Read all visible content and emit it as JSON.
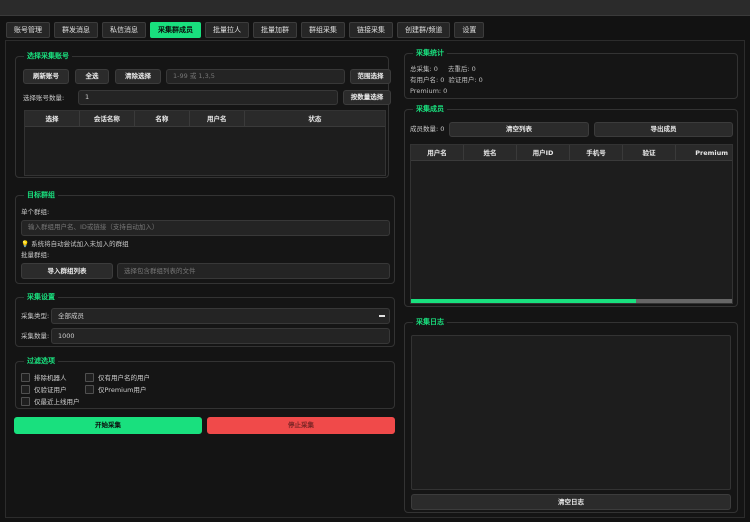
{
  "tabs": [
    {
      "label": "账号管理",
      "active": false
    },
    {
      "label": "群发消息",
      "active": false
    },
    {
      "label": "私信消息",
      "active": false
    },
    {
      "label": "采集群成员",
      "active": true
    },
    {
      "label": "批量拉人",
      "active": false
    },
    {
      "label": "批量加群",
      "active": false
    },
    {
      "label": "群组采集",
      "active": false
    },
    {
      "label": "链接采集",
      "active": false
    },
    {
      "label": "创建群/频道",
      "active": false
    },
    {
      "label": "设置",
      "active": false
    }
  ],
  "select_account": {
    "title": "选择采集账号",
    "refresh_label": "刷新账号",
    "select_all_label": "全选",
    "clear_label": "清除选择",
    "range_placeholder": "1-99 或 1,3,5",
    "range_select_label": "范围选择",
    "count_label": "选择账号数量:",
    "count_value": "1",
    "count_select_label": "按数量选择",
    "columns": [
      "选择",
      "会话名称",
      "名称",
      "用户名",
      "状态"
    ]
  },
  "target_group": {
    "title": "目标群组",
    "single_label": "单个群组:",
    "single_placeholder": "输入群组用户名、ID或链接（支持自动加入）",
    "hint": "系统将自动尝试加入未加入的群组",
    "batch_label": "批量群组:",
    "import_label": "导入群组列表",
    "file_placeholder": "选择包含群组列表的文件"
  },
  "settings": {
    "title": "采集设置",
    "type_label": "采集类型:",
    "type_value": "全部成员",
    "count_label": "采集数量:",
    "count_value": "1000"
  },
  "filters": {
    "title": "过滤选项",
    "exclude_bots": "排除机器人",
    "only_username": "仅有用户名的用户",
    "only_verified": "仅验证用户",
    "only_premium": "仅Premium用户",
    "only_recent": "仅最近上线用户"
  },
  "actions": {
    "start_label": "开始采集",
    "stop_label": "停止采集"
  },
  "stats": {
    "title": "采集统计",
    "total": "总采集: 0",
    "dedup": "去重后: 0",
    "has_username": "有用户名: 0",
    "verified": "验证用户: 0",
    "premium": "Premium: 0"
  },
  "members": {
    "title": "采集成员",
    "count_label": "成员数量: 0",
    "clear_label": "清空列表",
    "export_label": "导出成员",
    "columns": [
      "用户名",
      "姓名",
      "用户ID",
      "手机号",
      "验证",
      "Premium"
    ],
    "progress_percent": 70
  },
  "log": {
    "title": "采集日志",
    "clear_label": "清空日志"
  },
  "colors": {
    "accent": "#19e07e",
    "danger": "#f04a4a"
  }
}
